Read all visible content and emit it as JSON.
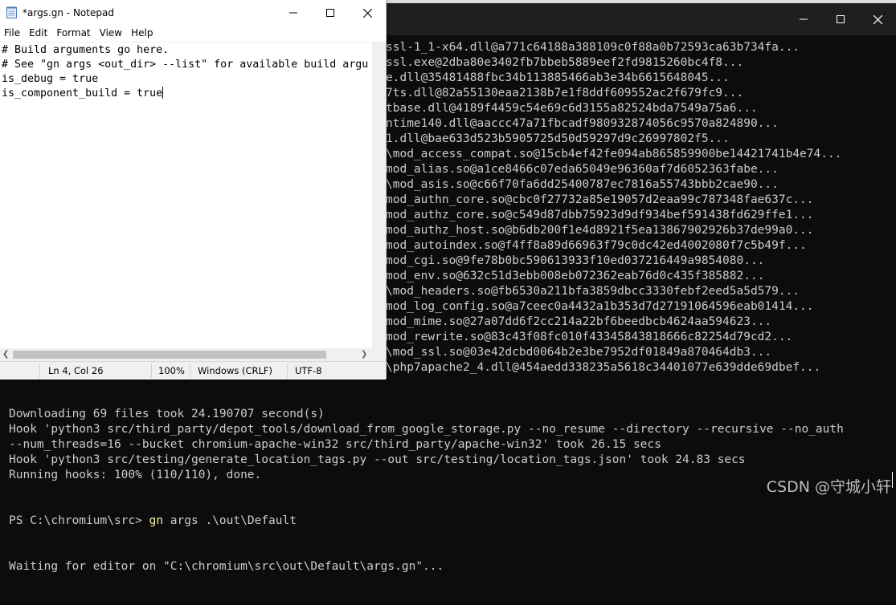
{
  "console": {
    "lines": [
      "ssl-1_1-x64.dll@a771c64188a388109c0f88a0b72593ca63b734fa...",
      "ssl.exe@2dba80e3402fb7bbeb5889eef2fd9815260bc4f8...",
      "e.dll@35481488fbc34b113885466ab3e34b6615648045...",
      "7ts.dll@82a55130eaa2138b7e1f8ddf609552ac2f679fc9...",
      "tbase.dll@4189f4459c54e69c6d3155a82524bda7549a75a6...",
      "ntime140.dll@aaccc47a71fbcadf980932874056c9570a824890...",
      "1.dll@bae633d523b5905725d50d59297d9c26997802f5...",
      "\\mod_access_compat.so@15cb4ef42fe094ab865859900be14421741b4e74...",
      "mod_alias.so@a1ce8466c07eda65049e96360af7d6052363fabe...",
      "\\mod_asis.so@c66f70fa6dd25400787ec7816a55743bbb2cae90...",
      "mod_authn_core.so@cbc0f27732a85e19057d2eaa99c787348fae637c...",
      "mod_authz_core.so@c549d87dbb75923d9df934bef591438fd629ffe1...",
      "mod_authz_host.so@b6db200f1e4d8921f5ea13867902926b37de99a0...",
      "mod_autoindex.so@f4ff8a89d66963f79c0dc42ed4002080f7c5b49f...",
      "mod_cgi.so@9fe78b0bc590613933f10ed037216449a9854080...",
      "mod_env.so@632c51d3ebb008eb072362eab76d0c435f385882...",
      "\\mod_headers.so@fb6530a211bfa3859dbcc3330febf2eed5a5d579...",
      "mod_log_config.so@a7ceec0a4432a1b353d7d27191064596eab01414...",
      "mod_mime.so@27a07dd6f2cc214a22bf6beedbcb4624aa594623...",
      "mod_rewrite.so@83c43f08fc010f43345843818666c82254d79cd2...",
      "\\mod_ssl.so@03e42dcbd0064b2e3be7952df01849a870464db3...",
      "\\php7apache2_4.dll@454aedd338235a5618c34401077e639dde69dbef..."
    ],
    "bottom_lines": [
      "Downloading 69 files took 24.190707 second(s)",
      "Hook 'python3 src/third_party/depot_tools/download_from_google_storage.py --no_resume --directory --recursive --no_auth",
      "--num_threads=16 --bucket chromium-apache-win32 src/third_party/apache-win32' took 26.15 secs",
      "Hook 'python3 src/testing/generate_location_tags.py --out src/testing/location_tags.json' took 24.83 secs",
      "Running hooks: 100% (110/110), done."
    ],
    "prompt": "PS C:\\chromium\\src> ",
    "command": "gn",
    "command_args": " args .\\out\\Default",
    "waiting": "Waiting for editor on \"C:\\chromium\\src\\out\\Default\\args.gn\"...",
    "watermark": "CSDN @守城小轩"
  },
  "notepad": {
    "title": "*args.gn - Notepad",
    "menu": [
      "File",
      "Edit",
      "Format",
      "View",
      "Help"
    ],
    "content_lines": [
      "# Build arguments go here.",
      "# See \"gn args <out_dir> --list\" for available build argu",
      "is_debug = true",
      "is_component_build = true"
    ],
    "status": {
      "position": "Ln 4, Col 26",
      "zoom": "100%",
      "line_endings": "Windows (CRLF)",
      "encoding": "UTF-8"
    }
  }
}
